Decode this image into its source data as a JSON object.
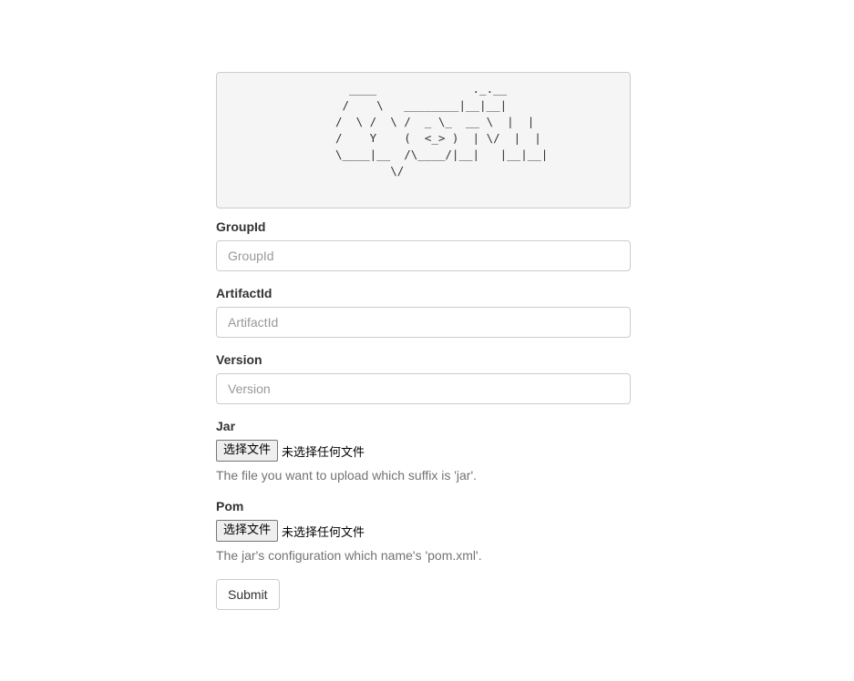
{
  "banner": {
    "ascii_art": "  ____              ._.__ \n /    \\   ________|__|__|\n/  \\ /  \\ /  _ \\_  __ \\  |  |\n/    Y    (  <_> )  | \\/  |  |\n\\____|__  /\\____/|__|   |__|__|\n        \\/"
  },
  "form": {
    "groupid": {
      "label": "GroupId",
      "placeholder": "GroupId"
    },
    "artifactid": {
      "label": "ArtifactId",
      "placeholder": "ArtifactId"
    },
    "version": {
      "label": "Version",
      "placeholder": "Version"
    },
    "jar": {
      "label": "Jar",
      "button_label": "选择文件",
      "status": "未选择任何文件",
      "help": "The file you want to upload which suffix is 'jar'."
    },
    "pom": {
      "label": "Pom",
      "button_label": "选择文件",
      "status": "未选择任何文件",
      "help": "The jar's configuration which name's 'pom.xml'."
    },
    "submit_label": "Submit"
  }
}
